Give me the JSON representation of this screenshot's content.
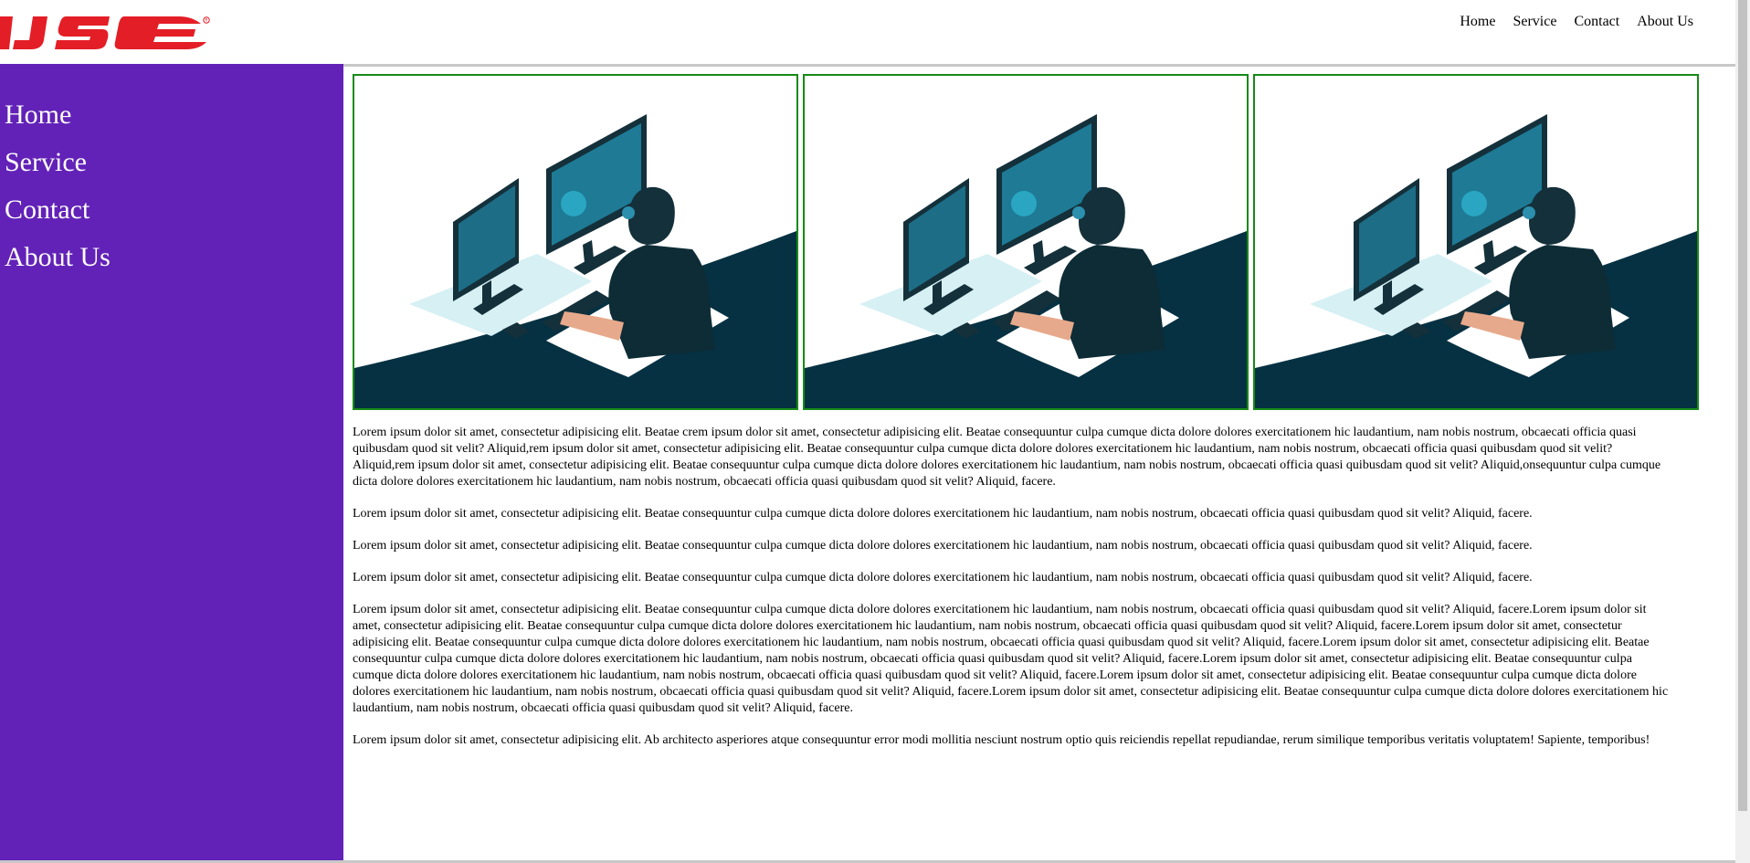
{
  "brand": {
    "logo_text": "IJSE",
    "logo_color": "#e41e26"
  },
  "header": {
    "nav": [
      {
        "label": "Home"
      },
      {
        "label": "Service"
      },
      {
        "label": "Contact"
      },
      {
        "label": "About Us"
      }
    ]
  },
  "sidebar": {
    "background": "#6222b7",
    "items": [
      {
        "label": "Home"
      },
      {
        "label": "Service"
      },
      {
        "label": "Contact"
      },
      {
        "label": "About Us"
      }
    ]
  },
  "gallery": {
    "border_color": "#168a16",
    "images": [
      {
        "icon": "developer-at-computer-illustration"
      },
      {
        "icon": "developer-at-computer-illustration"
      },
      {
        "icon": "developer-at-computer-illustration"
      }
    ]
  },
  "content": {
    "paragraphs": [
      "Lorem ipsum dolor sit amet, consectetur adipisicing elit. Beatae crem ipsum dolor sit amet, consectetur adipisicing elit. Beatae consequuntur culpa cumque dicta dolore dolores exercitationem hic laudantium, nam nobis nostrum, obcaecati officia quasi quibusdam quod sit velit? Aliquid,rem ipsum dolor sit amet, consectetur adipisicing elit. Beatae consequuntur culpa cumque dicta dolore dolores exercitationem hic laudantium, nam nobis nostrum, obcaecati officia quasi quibusdam quod sit velit? Aliquid,rem ipsum dolor sit amet, consectetur adipisicing elit. Beatae consequuntur culpa cumque dicta dolore dolores exercitationem hic laudantium, nam nobis nostrum, obcaecati officia quasi quibusdam quod sit velit? Aliquid,onsequuntur culpa cumque dicta dolore dolores exercitationem hic laudantium, nam nobis nostrum, obcaecati officia quasi quibusdam quod sit velit? Aliquid, facere.",
      "Lorem ipsum dolor sit amet, consectetur adipisicing elit. Beatae consequuntur culpa cumque dicta dolore dolores exercitationem hic laudantium, nam nobis nostrum, obcaecati officia quasi quibusdam quod sit velit? Aliquid, facere.",
      "Lorem ipsum dolor sit amet, consectetur adipisicing elit. Beatae consequuntur culpa cumque dicta dolore dolores exercitationem hic laudantium, nam nobis nostrum, obcaecati officia quasi quibusdam quod sit velit? Aliquid, facere.",
      "Lorem ipsum dolor sit amet, consectetur adipisicing elit. Beatae consequuntur culpa cumque dicta dolore dolores exercitationem hic laudantium, nam nobis nostrum, obcaecati officia quasi quibusdam quod sit velit? Aliquid, facere.",
      "Lorem ipsum dolor sit amet, consectetur adipisicing elit. Beatae consequuntur culpa cumque dicta dolore dolores exercitationem hic laudantium, nam nobis nostrum, obcaecati officia quasi quibusdam quod sit velit? Aliquid, facere.Lorem ipsum dolor sit amet, consectetur adipisicing elit. Beatae consequuntur culpa cumque dicta dolore dolores exercitationem hic laudantium, nam nobis nostrum, obcaecati officia quasi quibusdam quod sit velit? Aliquid, facere.Lorem ipsum dolor sit amet, consectetur adipisicing elit. Beatae consequuntur culpa cumque dicta dolore dolores exercitationem hic laudantium, nam nobis nostrum, obcaecati officia quasi quibusdam quod sit velit? Aliquid, facere.Lorem ipsum dolor sit amet, consectetur adipisicing elit. Beatae consequuntur culpa cumque dicta dolore dolores exercitationem hic laudantium, nam nobis nostrum, obcaecati officia quasi quibusdam quod sit velit? Aliquid, facere.Lorem ipsum dolor sit amet, consectetur adipisicing elit. Beatae consequuntur culpa cumque dicta dolore dolores exercitationem hic laudantium, nam nobis nostrum, obcaecati officia quasi quibusdam quod sit velit? Aliquid, facere.Lorem ipsum dolor sit amet, consectetur adipisicing elit. Beatae consequuntur culpa cumque dicta dolore dolores exercitationem hic laudantium, nam nobis nostrum, obcaecati officia quasi quibusdam quod sit velit? Aliquid, facere.Lorem ipsum dolor sit amet, consectetur adipisicing elit. Beatae consequuntur culpa cumque dicta dolore dolores exercitationem hic laudantium, nam nobis nostrum, obcaecati officia quasi quibusdam quod sit velit? Aliquid, facere.",
      "Lorem ipsum dolor sit amet, consectetur adipisicing elit. Ab architecto asperiores atque consequuntur error modi mollitia nesciunt nostrum optio quis reiciendis repellat repudiandae, rerum similique temporibus veritatis voluptatem! Sapiente, temporibus!"
    ]
  }
}
